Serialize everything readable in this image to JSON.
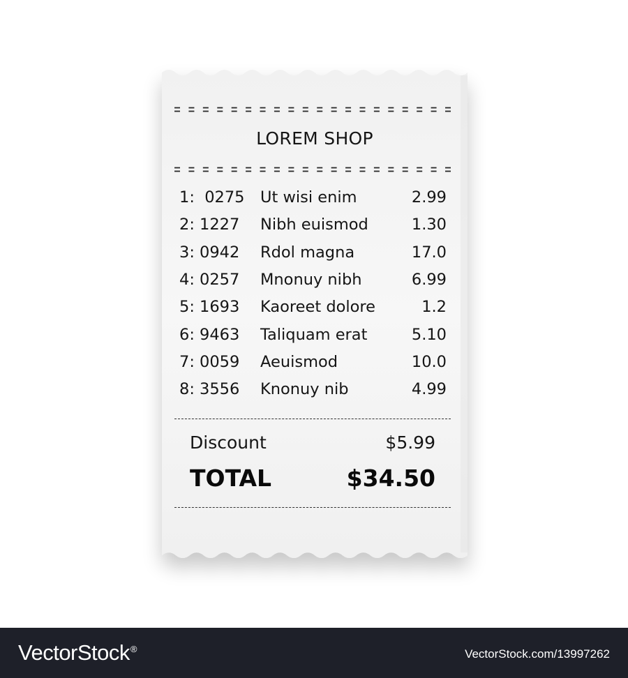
{
  "receipt": {
    "shop_name": "LOREM SHOP",
    "items": [
      {
        "code": "1:  0275",
        "name": "Ut wisi enim",
        "price": "2.99"
      },
      {
        "code": "2: 1227",
        "name": "Nibh euismod",
        "price": "1.30"
      },
      {
        "code": "3: 0942",
        "name": "Rdol magna",
        "price": "17.0"
      },
      {
        "code": "4: 0257",
        "name": "Mnonuy nibh",
        "price": "6.99"
      },
      {
        "code": "5: 1693",
        "name": "Kaoreet dolore",
        "price": "1.2"
      },
      {
        "code": "6: 9463",
        "name": "Taliquam erat",
        "price": "5.10"
      },
      {
        "code": "7: 0059",
        "name": "Aeuismod",
        "price": "10.0"
      },
      {
        "code": "8: 3556",
        "name": "Knonuy nib",
        "price": "4.99"
      }
    ],
    "discount_label": "Discount",
    "discount_value": "$5.99",
    "total_label": "TOTAL",
    "total_value": "$34.50"
  },
  "footer": {
    "brand": "VectorStock",
    "reg_mark": "®",
    "url": "VectorStock.com/13997262",
    "background_color": "#1e2029"
  },
  "colors": {
    "paper": "#f4f4f4",
    "text": "#151515",
    "background": "#ffffff"
  }
}
